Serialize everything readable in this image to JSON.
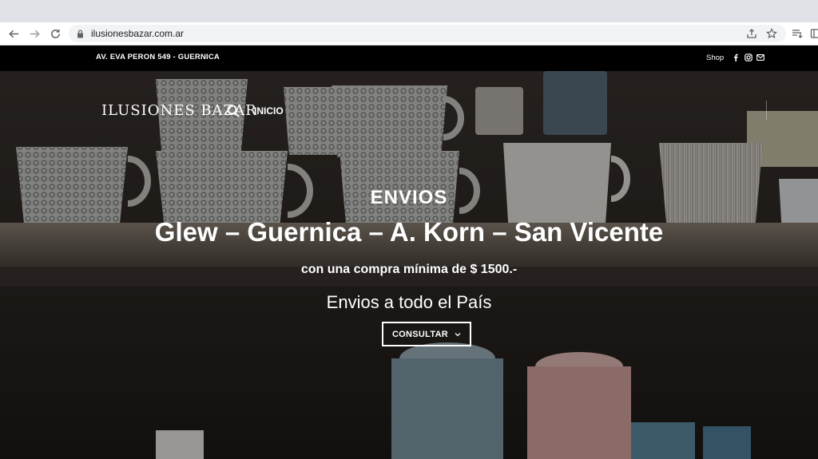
{
  "browser": {
    "url": "ilusionesbazar.com.ar"
  },
  "topbar": {
    "address": "AV. EVA PERON 549 - GUERNICA",
    "shop_label": "Shop"
  },
  "header": {
    "logo_text": "ILUSIONES BAZAR",
    "nav": [
      {
        "label": "INICIO"
      }
    ]
  },
  "hero": {
    "heading": "ENVIOS",
    "towns": "Glew – Guernica – A. Korn – San Vicente",
    "min_purchase": "con una compra mínima de $ 1500.-",
    "nationwide": "Envios a todo el País",
    "button_label": "CONSULTAR"
  },
  "colors": {
    "topbar_bg": "#000000",
    "text": "#ffffff",
    "browser_tabstrip": "#dee1e6"
  },
  "icons": [
    "back-icon",
    "forward-icon",
    "reload-icon",
    "lock-icon",
    "share-icon",
    "star-icon",
    "reading-list-icon",
    "side-panel-icon",
    "facebook-icon",
    "instagram-icon",
    "mail-icon",
    "search-icon",
    "chevron-down-icon"
  ]
}
